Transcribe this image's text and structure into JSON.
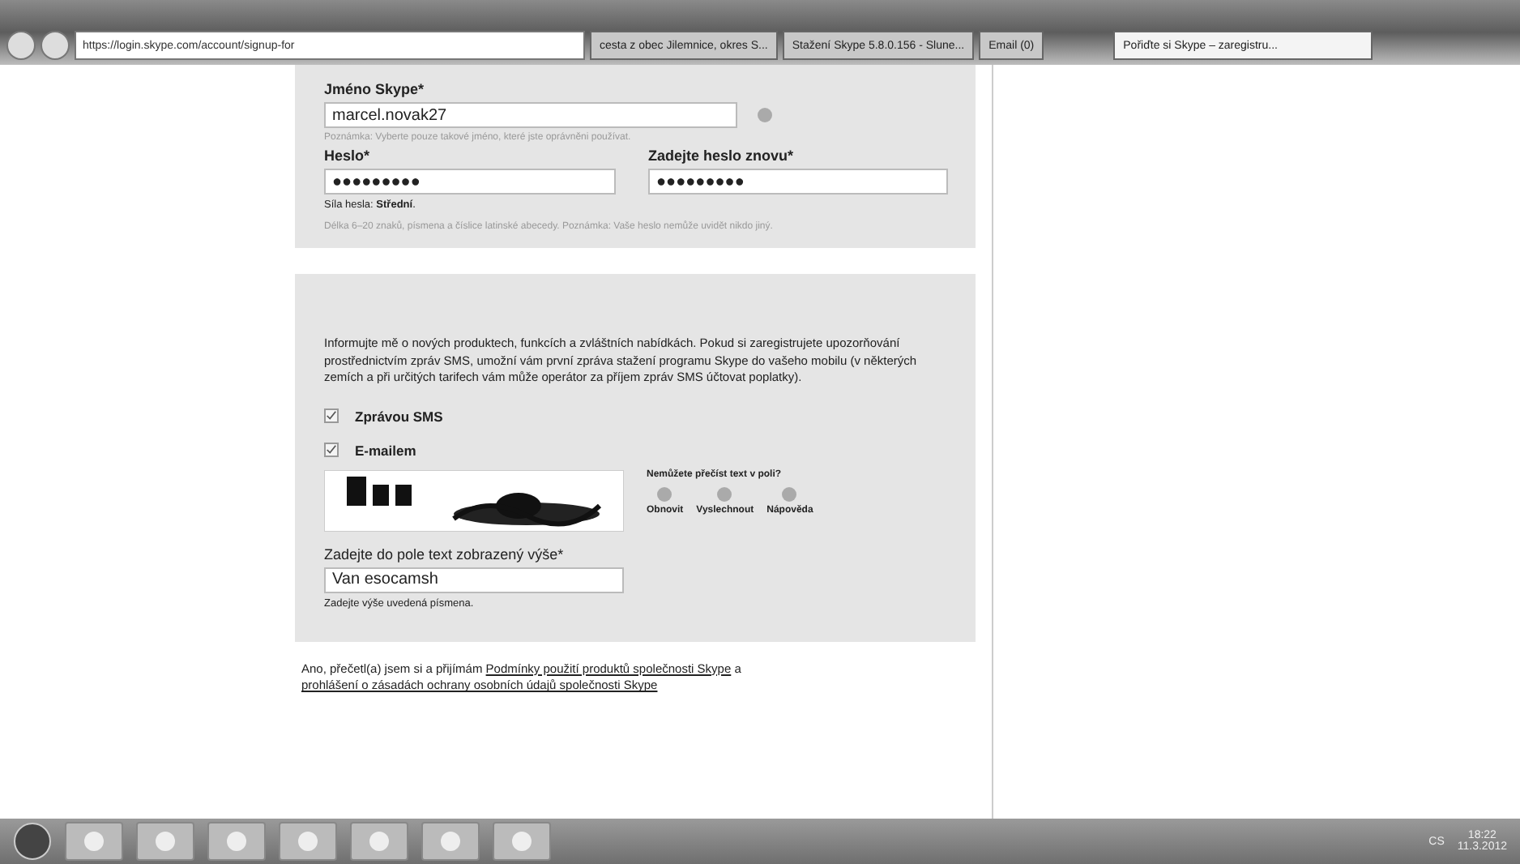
{
  "browser": {
    "address": "https://login.skype.com/account/signup-for",
    "tabs": [
      {
        "label": "cesta z obec Jilemnice, okres S...",
        "selected": false
      },
      {
        "label": "Stažení Skype 5.8.0.156 - Slune...",
        "selected": false
      },
      {
        "label": "Email (0)",
        "selected": false
      },
      {
        "label": "Pořiďte si Skype – zaregistru...",
        "selected": true
      }
    ]
  },
  "account": {
    "username_label": "Jméno Skype*",
    "username": "marcel.novak27",
    "username_note": "Poznámka: Vyberte pouze takové jméno, které jste oprávněni používat.",
    "password_label": "Heslo*",
    "password": "●●●●●●●●●",
    "repeat_label": "Zadejte heslo znovu*",
    "repeat": "●●●●●●●●●",
    "strength": "Síla hesla: **Střední**.",
    "password_note": "Délka 6–20 znaků, písmena a číslice latinské abecedy. Poznámka: Vaše heslo nemůže uvidět nikdo jiný."
  },
  "offers": {
    "text": "Informujte mě o nových produktech, funkcích a zvláštních nabídkách. Pokud si zaregistrujete upozorňování prostřednictvím zpráv SMS, umožní vám první zpráva stažení programu Skype do vašeho mobilu (v některých zemích a při určitých tarifech vám může operátor za příjem zpráv SMS účtovat poplatky).",
    "options": [
      {
        "label": "Zprávou SMS",
        "checked": true
      },
      {
        "label": "E-mailem",
        "checked": true
      }
    ]
  },
  "captcha": {
    "kind": "picture",
    "question": "Nemůžete přečíst text v poli?",
    "actions": [
      "Obnovit",
      "Vyslechnout",
      "Nápověda"
    ],
    "label": "Zadejte do pole text zobrazený výše*",
    "value": "Van esocamsh",
    "hint": "Zadejte výše uvedená písmena."
  },
  "terms": {
    "prefix": "Ano, přečetl(a) jsem si a přijímám",
    "link1": "Podmínky použití produktů společnosti Skype",
    "middle": "a",
    "link2": "prohlášení o zásadách ochrany osobních údajů společnosti Skype"
  },
  "tray": {
    "language": "CS",
    "time": "18:22",
    "date": "11.3.2012"
  }
}
